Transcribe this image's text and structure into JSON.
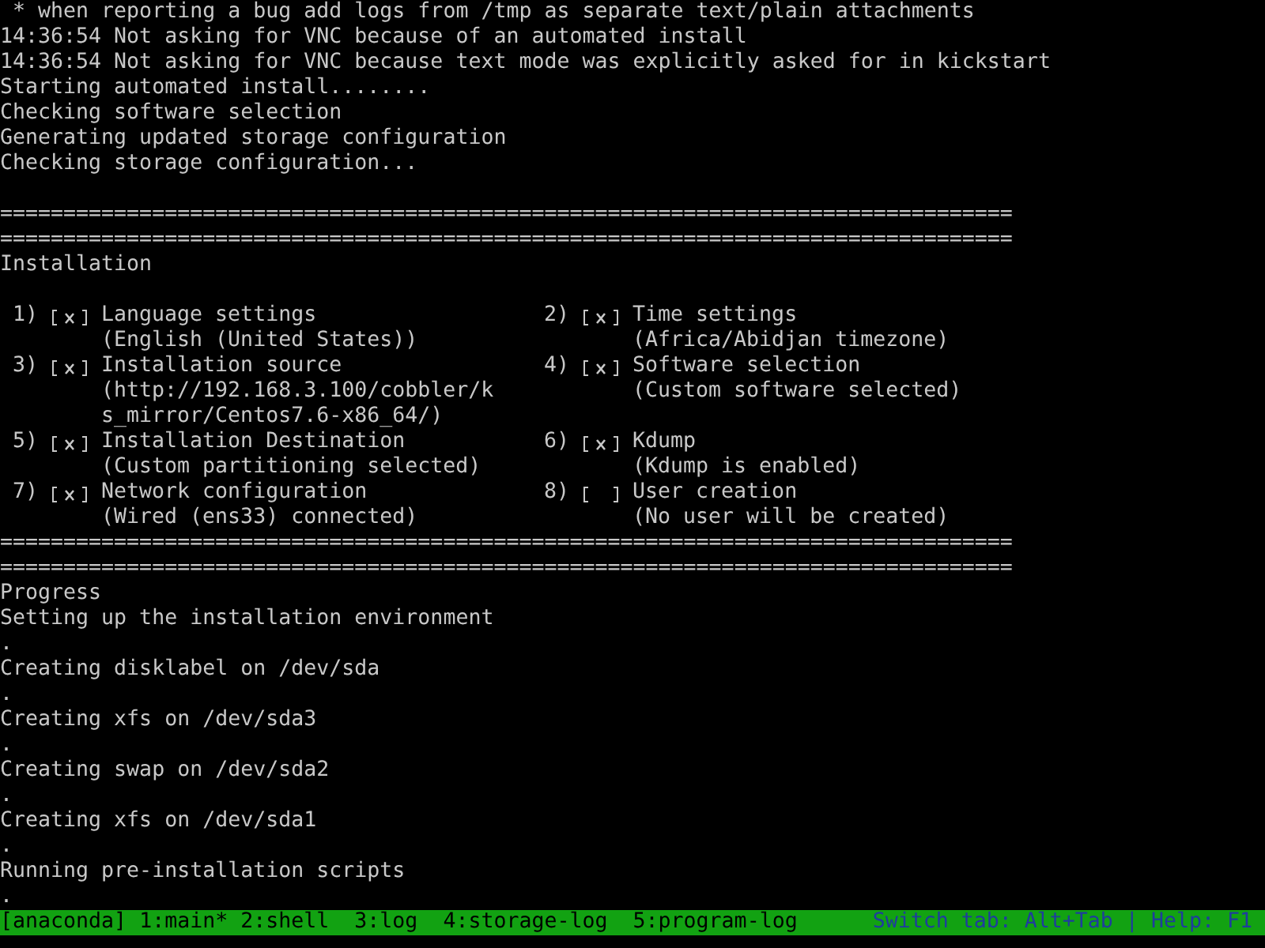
{
  "log_lines": [
    " * when reporting a bug add logs from /tmp as separate text/plain attachments",
    "14:36:54 Not asking for VNC because of an automated install",
    "14:36:54 Not asking for VNC because text mode was explicitly asked for in kickstart",
    "Starting automated install........",
    "Checking software selection",
    "Generating updated storage configuration",
    "Checking storage configuration..."
  ],
  "installation": {
    "separators_top": [
      "================================================================================",
      "================================================================================"
    ],
    "title": "Installation",
    "spokes": [
      {
        "number": "1)",
        "checked": true,
        "title": "Language settings",
        "detail": [
          "(English (United States))"
        ]
      },
      {
        "number": "2)",
        "checked": true,
        "title": "Time settings",
        "detail": [
          "(Africa/Abidjan timezone)"
        ]
      },
      {
        "number": "3)",
        "checked": true,
        "title": "Installation source",
        "detail": [
          "(http://192.168.3.100/cobbler/k",
          "s_mirror/Centos7.6-x86_64/)"
        ]
      },
      {
        "number": "4)",
        "checked": true,
        "title": "Software selection",
        "detail": [
          "(Custom software selected)"
        ]
      },
      {
        "number": "5)",
        "checked": true,
        "title": "Installation Destination",
        "detail": [
          "(Custom partitioning selected)"
        ]
      },
      {
        "number": "6)",
        "checked": true,
        "title": "Kdump",
        "detail": [
          "(Kdump is enabled)"
        ]
      },
      {
        "number": "7)",
        "checked": true,
        "title": "Network configuration",
        "detail": [
          "(Wired (ens33) connected)"
        ]
      },
      {
        "number": "8)",
        "checked": false,
        "title": "User creation",
        "detail": [
          "(No user will be created)"
        ]
      }
    ],
    "separators_bottom": [
      "================================================================================",
      "================================================================================"
    ]
  },
  "progress": {
    "title": "Progress",
    "lines": [
      "Setting up the installation environment",
      ".",
      "Creating disklabel on /dev/sda",
      ".",
      "Creating xfs on /dev/sda3",
      ".",
      "Creating swap on /dev/sda2",
      ".",
      "Creating xfs on /dev/sda1",
      ".",
      "Running pre-installation scripts",
      "."
    ]
  },
  "status_bar": {
    "app": "[anaconda]",
    "tabs": [
      "1:main*",
      "2:shell",
      "3:log",
      "4:storage-log",
      "5:program-log"
    ],
    "hint": "Switch tab: Alt+Tab | Help: F1"
  }
}
